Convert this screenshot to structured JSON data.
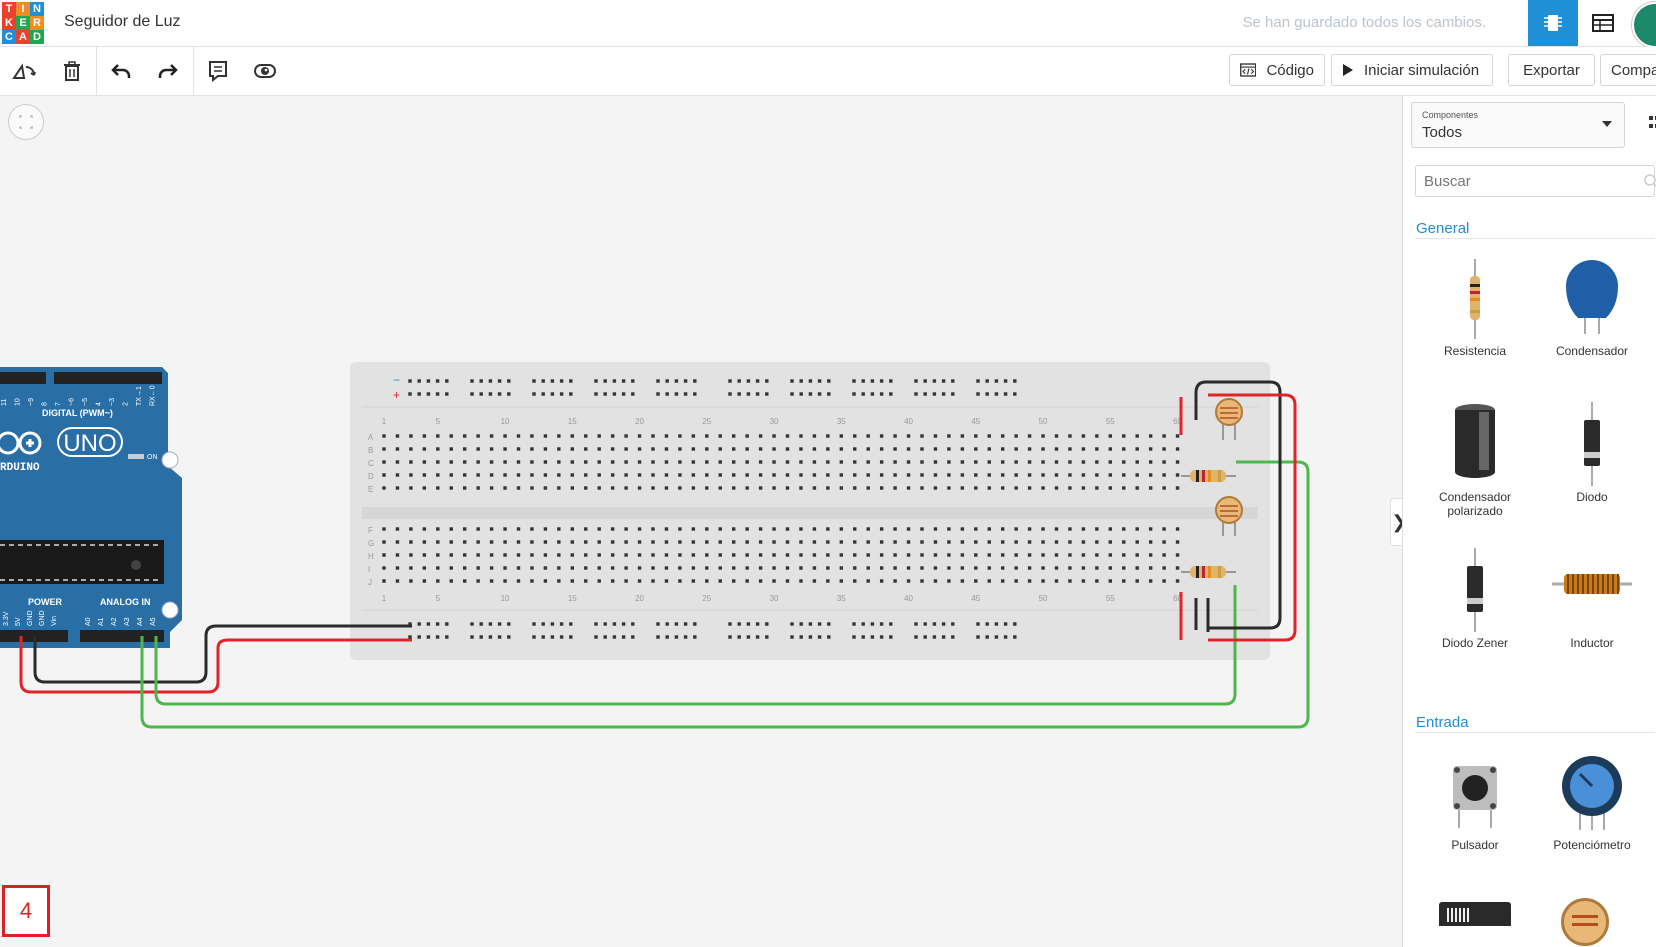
{
  "app": {
    "logo_letters": [
      "T",
      "I",
      "N",
      "K",
      "E",
      "R",
      "C",
      "A",
      "D"
    ],
    "logo_colors": [
      "#e8412c",
      "#f08c23",
      "#1f8fd6",
      "#e8412c",
      "#1fa84f",
      "#f08c23",
      "#1f8fd6",
      "#e8412c",
      "#1fa84f"
    ],
    "document_title": "Seguidor de Luz",
    "save_status": "Se han guardado todos los cambios."
  },
  "toolbar": {
    "left_icons": [
      "rotate-icon",
      "trash-icon",
      "undo-icon",
      "redo-icon",
      "notes-icon",
      "view-icon"
    ],
    "code_label": "Código",
    "simulate_label": "Iniciar simulación",
    "export_label": "Exportar",
    "share_label": "Compart"
  },
  "canvas": {
    "board_labels": {
      "digital": "DIGITAL (PWM~)",
      "brand": "RDUINO",
      "model": "UNO",
      "on": "ON",
      "power": "POWER",
      "analog": "ANALOG IN",
      "digital_pins": [
        "11",
        "10",
        "~9",
        "8",
        "7",
        "~6",
        "~5",
        "4",
        "~3",
        "2",
        "TX→1",
        "RX←0"
      ],
      "power_pins": [
        "3.3V",
        "5V",
        "GND",
        "GND",
        "Vin"
      ],
      "analog_pins": [
        "A0",
        "A1",
        "A2",
        "A3",
        "A4",
        "A5"
      ]
    },
    "breadboard": {
      "column_numbers": [
        "1",
        "5",
        "10",
        "15",
        "20",
        "25",
        "30",
        "35",
        "40",
        "45",
        "50",
        "55",
        "60"
      ],
      "row_letters_top": [
        "A",
        "B",
        "C",
        "D",
        "E"
      ],
      "row_letters_bottom": [
        "F",
        "G",
        "H",
        "I",
        "J"
      ],
      "rail_minus": "−",
      "rail_plus": "+"
    },
    "page_indicator": "4"
  },
  "panel": {
    "components_label": "Componentes",
    "components_value": "Todos",
    "search_placeholder": "Buscar",
    "sections": {
      "general": "General",
      "input": "Entrada"
    },
    "general_items": [
      "Resistencia",
      "Condensador",
      "Condensador polarizado",
      "Diodo",
      "Diodo Zener",
      "Inductor"
    ],
    "input_items": [
      "Pulsador",
      "Potenciómetro"
    ],
    "collapse_glyph": "❯"
  },
  "colors": {
    "accent": "#1f8fd6",
    "arduino": "#2a6ea6",
    "wire_red": "#e0252a",
    "wire_black": "#2b2b2b",
    "wire_green": "#4cb84c",
    "breadboard": "#e2e2e2"
  }
}
